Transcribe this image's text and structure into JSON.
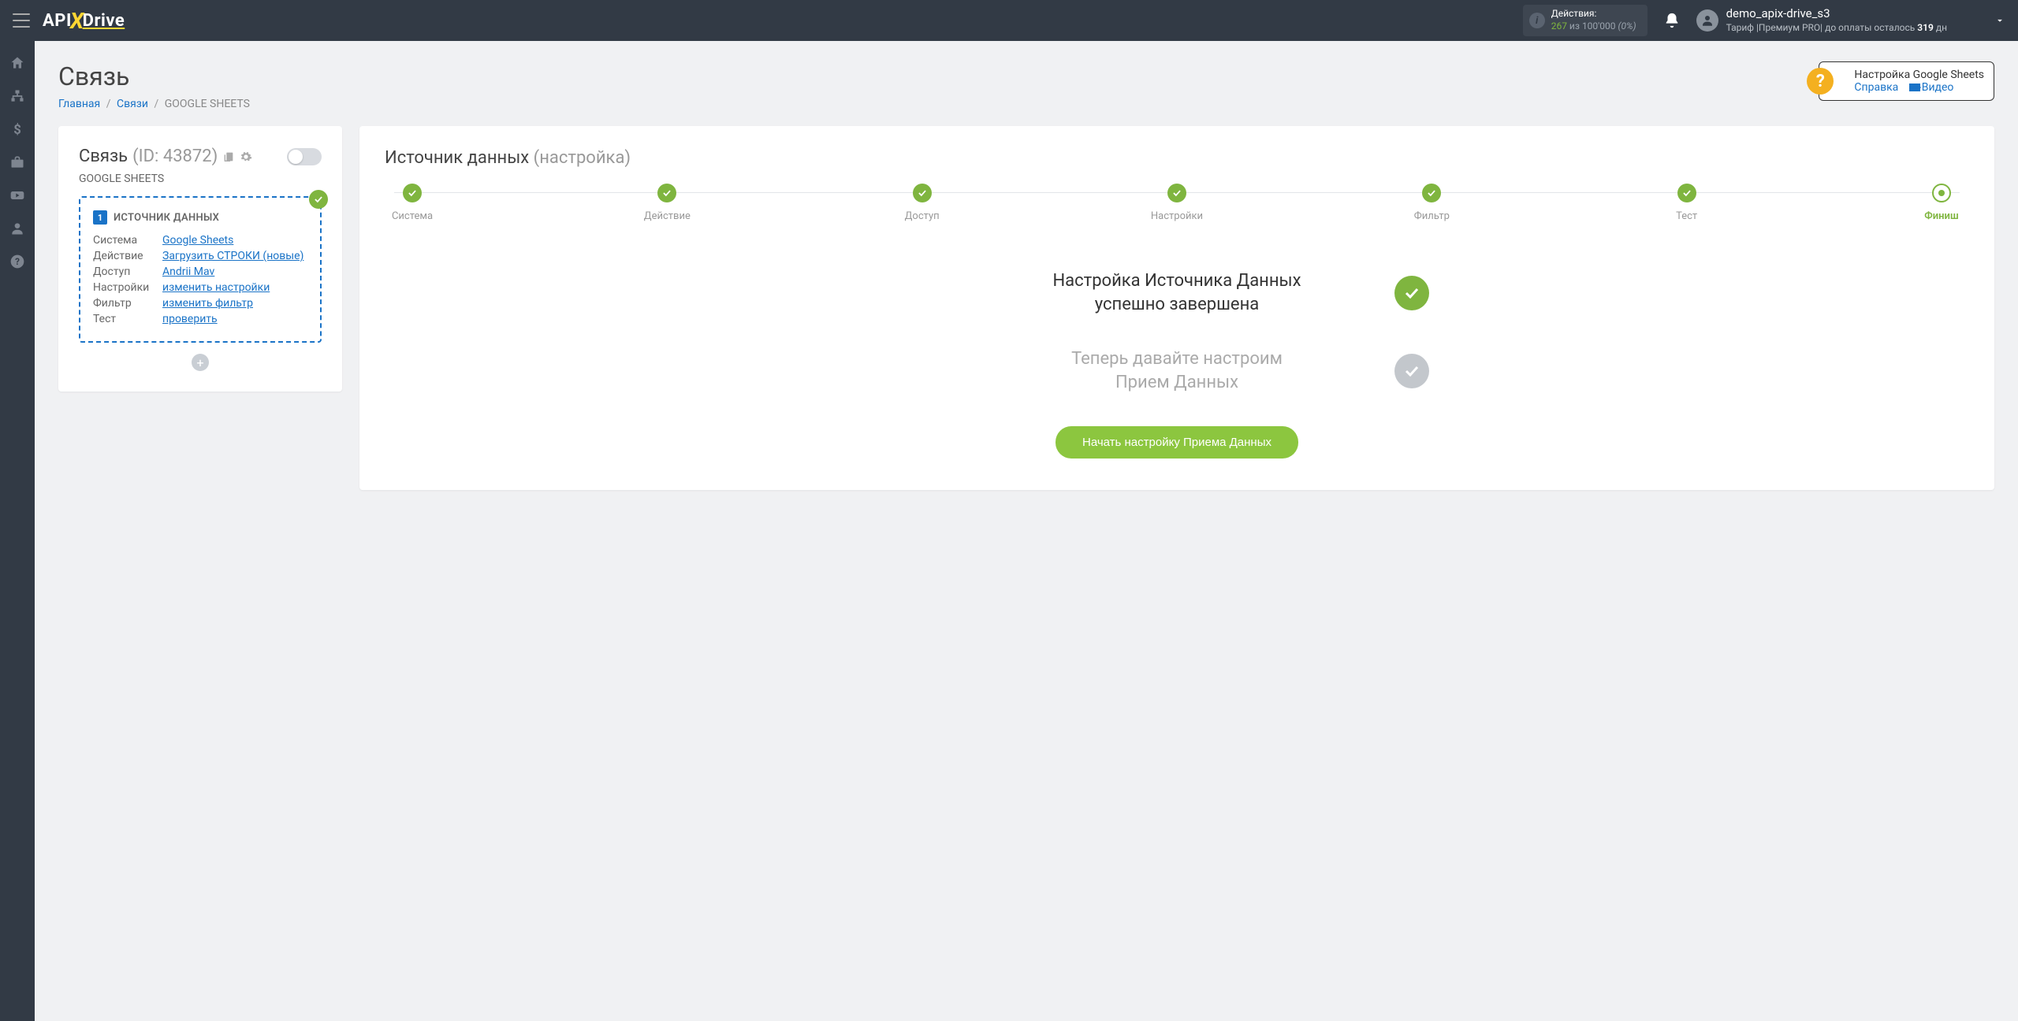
{
  "logo": {
    "part1": "API",
    "part2": "Drive"
  },
  "topbar": {
    "actions_label": "Действия:",
    "actions_count": "267",
    "actions_sep": "из",
    "actions_total": "100'000",
    "actions_pct": "(0%)",
    "username": "demo_apix-drive_s3",
    "tariff_prefix": "Тариф |",
    "tariff_name": "Премиум PRO",
    "tariff_sep": "|",
    "days_prefix": "до оплаты осталось",
    "days_value": "319",
    "days_suffix": "дн"
  },
  "page": {
    "title": "Связь"
  },
  "breadcrumb": {
    "home": "Главная",
    "links": "Связи",
    "current": "GOOGLE SHEETS"
  },
  "help": {
    "title": "Настройка Google Sheets",
    "ref": "Справка",
    "video": "Видео"
  },
  "left": {
    "title": "Связь",
    "id": "(ID: 43872)",
    "subtitle": "GOOGLE SHEETS",
    "source_head": "ИСТОЧНИК ДАННЫХ",
    "source_num": "1",
    "rows": [
      {
        "k": "Система",
        "v": "Google Sheets"
      },
      {
        "k": "Действие",
        "v": "Загрузить СТРОКИ (новые)"
      },
      {
        "k": "Доступ",
        "v": "Andrii Mav"
      },
      {
        "k": "Настройки",
        "v": "изменить настройки"
      },
      {
        "k": "Фильтр",
        "v": "изменить фильтр"
      },
      {
        "k": "Тест",
        "v": "проверить"
      }
    ]
  },
  "right": {
    "title_main": "Источник данных",
    "title_sub": "(настройка)",
    "steps": [
      "Система",
      "Действие",
      "Доступ",
      "Настройки",
      "Фильтр",
      "Тест",
      "Финиш"
    ],
    "success_line1": "Настройка Источника Данных",
    "success_line2": "успешно завершена",
    "next_line1": "Теперь давайте настроим",
    "next_line2": "Прием Данных",
    "cta": "Начать настройку Приема Данных"
  }
}
